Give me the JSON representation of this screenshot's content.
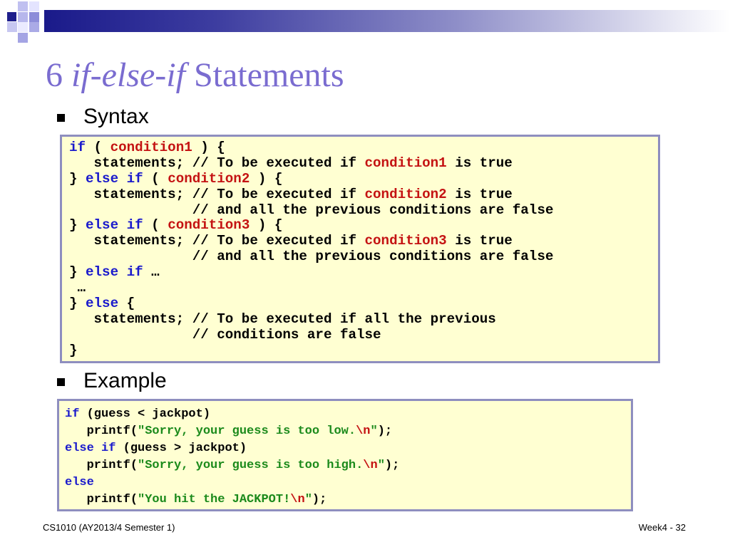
{
  "slide": {
    "title_number": "6",
    "title_italic": "if-else-if",
    "title_rest": "Statements",
    "bullet_syntax": "Syntax",
    "bullet_example": "Example"
  },
  "syntax_code": {
    "l1": {
      "kw1": "if",
      "t1": " ( ",
      "c1": "condition1",
      "t2": " ) {"
    },
    "l2": {
      "t1": "   statements; // To be executed if ",
      "c1": "condition1",
      "t2": " is true"
    },
    "l3": {
      "t0": "} ",
      "kw1": "else",
      "t1": " ",
      "kw2": "if",
      "t2": " ( ",
      "c1": "condition2",
      "t3": " ) {"
    },
    "l4": {
      "t1": "   statements; // To be executed if ",
      "c1": "condition2",
      "t2": " is true"
    },
    "l5": {
      "t1": "               // and all the previous conditions are false"
    },
    "l6": {
      "t0": "} ",
      "kw1": "else",
      "t1": " ",
      "kw2": "if",
      "t2": " ( ",
      "c1": "condition3",
      "t3": " ) {"
    },
    "l7": {
      "t1": "   statements; // To be executed if ",
      "c1": "condition3",
      "t2": " is true"
    },
    "l8": {
      "t1": "               // and all the previous conditions are false"
    },
    "l9": {
      "t0": "} ",
      "kw1": "else",
      "t1": " ",
      "kw2": "if",
      "t2": " …"
    },
    "l10": {
      "t1": " …"
    },
    "l11": {
      "t0": "} ",
      "kw1": "else",
      "t1": " {"
    },
    "l12": {
      "t1": "   statements; // To be executed if all the previous"
    },
    "l13": {
      "t1": "               // conditions are false"
    },
    "l14": {
      "t1": "}"
    }
  },
  "example_code": {
    "l1": {
      "kw1": "if",
      "t1": " (guess < jackpot)"
    },
    "l2": {
      "t0": "   printf(",
      "s1": "\"Sorry, your guess is too low.",
      "e1": "\\n",
      "s2": "\"",
      "t1": ");"
    },
    "l3": {
      "kw1": "else",
      "t1": " ",
      "kw2": "if",
      "t2": " (guess > jackpot)"
    },
    "l4": {
      "t0": "   printf(",
      "s1": "\"Sorry, your guess is too high.",
      "e1": "\\n",
      "s2": "\"",
      "t1": ");"
    },
    "l5": {
      "kw1": "else"
    },
    "l6": {
      "t0": "   printf(",
      "s1": "\"You hit the JACKPOT!",
      "e1": "\\n",
      "s2": "\"",
      "t1": ");"
    }
  },
  "footer": {
    "left": "CS1010 (AY2013/4 Semester 1)",
    "right": "Week4 - 32"
  },
  "colors": {
    "title": "#7a6cd0",
    "keyword": "#1a1acc",
    "condition": "#c41212",
    "string": "#1b8a1b",
    "code_bg": "#ffffd2",
    "code_border": "#8e8ebf"
  }
}
